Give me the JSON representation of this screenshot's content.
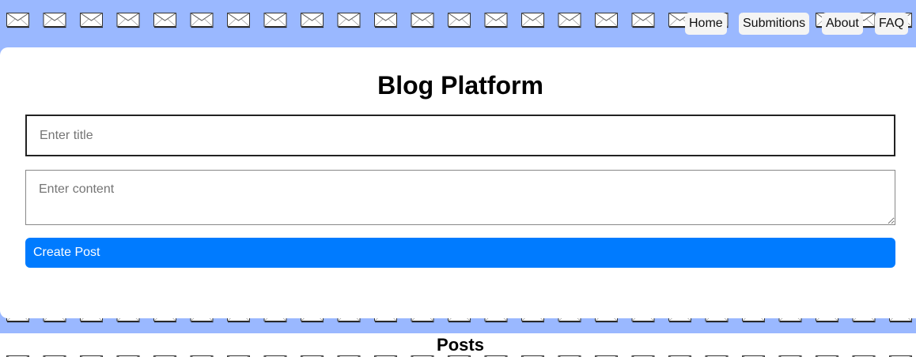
{
  "nav": {
    "items": [
      {
        "label": "Home"
      },
      {
        "label": "Submitions"
      },
      {
        "label": "About"
      },
      {
        "label": "FAQ"
      }
    ]
  },
  "form": {
    "heading": "Blog Platform",
    "title_placeholder": "Enter title",
    "content_placeholder": "Enter content",
    "submit_label": "Create Post"
  },
  "posts": {
    "heading": "Posts"
  },
  "colors": {
    "background": "#9ab8ff",
    "card": "#ffffff",
    "accent": "#007bff"
  },
  "background_pattern": {
    "icon": "envelope-icon"
  }
}
